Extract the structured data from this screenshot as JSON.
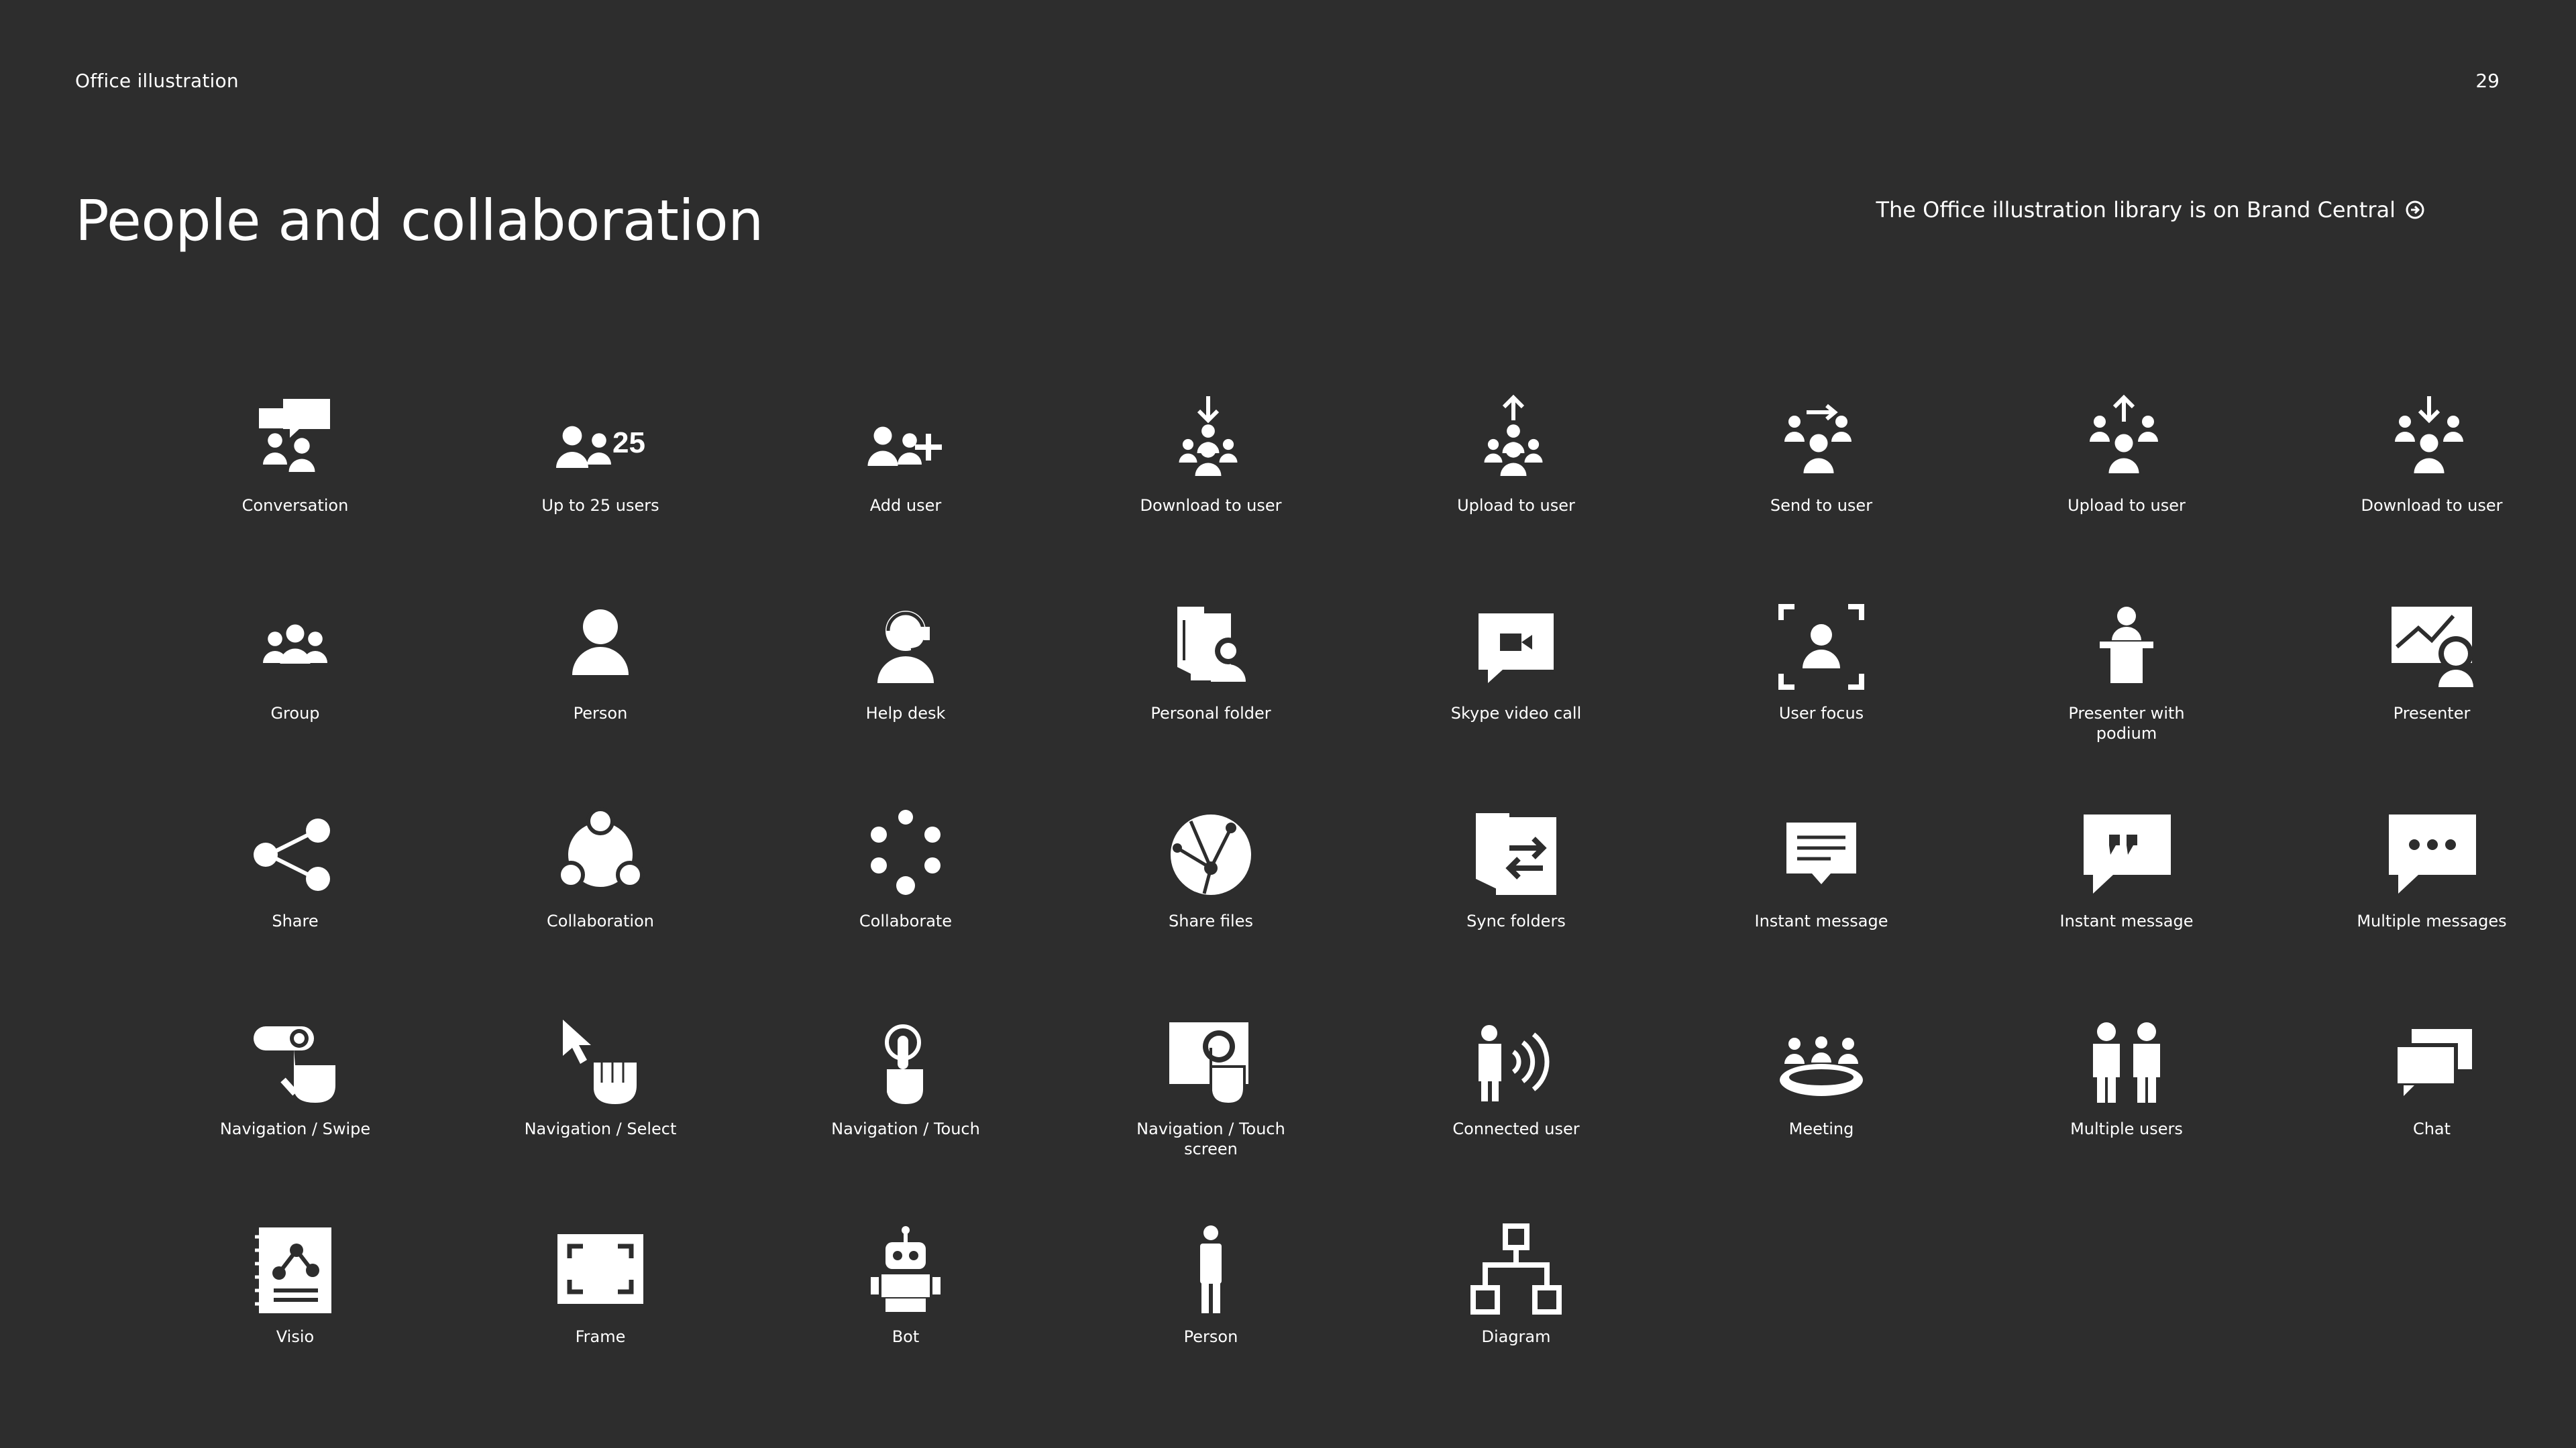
{
  "header": {
    "section": "Office illustration",
    "page_number": "29",
    "title": "People and collaboration",
    "link_text": "The Office illustration library is on Brand Central"
  },
  "icons": [
    {
      "label": "Conversation",
      "icon": "conversation-icon"
    },
    {
      "label": "Up to 25 users",
      "icon": "up-to-25-users-icon"
    },
    {
      "label": "Add user",
      "icon": "add-user-icon"
    },
    {
      "label": "Download to user",
      "icon": "download-to-user-icon"
    },
    {
      "label": "Upload to user",
      "icon": "upload-to-user-icon"
    },
    {
      "label": "Send to user",
      "icon": "send-to-user-icon"
    },
    {
      "label": "Upload to user",
      "icon": "upload-to-user-alt-icon"
    },
    {
      "label": "Download to user",
      "icon": "download-to-user-alt-icon"
    },
    {
      "label": "Group",
      "icon": "group-icon"
    },
    {
      "label": "Person",
      "icon": "person-icon"
    },
    {
      "label": "Help desk",
      "icon": "help-desk-icon"
    },
    {
      "label": "Personal folder",
      "icon": "personal-folder-icon"
    },
    {
      "label": "Skype video call",
      "icon": "skype-video-call-icon"
    },
    {
      "label": "User focus",
      "icon": "user-focus-icon"
    },
    {
      "label": "Presenter with podium",
      "icon": "presenter-podium-icon"
    },
    {
      "label": "Presenter",
      "icon": "presenter-icon"
    },
    {
      "label": "Share",
      "icon": "share-icon"
    },
    {
      "label": "Collaboration",
      "icon": "collaboration-icon"
    },
    {
      "label": "Collaborate",
      "icon": "collaborate-icon"
    },
    {
      "label": "Share files",
      "icon": "share-files-icon"
    },
    {
      "label": "Sync folders",
      "icon": "sync-folders-icon"
    },
    {
      "label": "Instant message",
      "icon": "instant-message-icon"
    },
    {
      "label": "Instant message",
      "icon": "instant-message-quote-icon"
    },
    {
      "label": "Multiple messages",
      "icon": "multiple-messages-icon"
    },
    {
      "label": "Navigation / Swipe",
      "icon": "navigation-swipe-icon"
    },
    {
      "label": "Navigation / Select",
      "icon": "navigation-select-icon"
    },
    {
      "label": "Navigation / Touch",
      "icon": "navigation-touch-icon"
    },
    {
      "label": "Navigation / Touch screen",
      "icon": "navigation-touch-screen-icon"
    },
    {
      "label": "Connected user",
      "icon": "connected-user-icon"
    },
    {
      "label": "Meeting",
      "icon": "meeting-icon"
    },
    {
      "label": "Multiple users",
      "icon": "multiple-users-icon"
    },
    {
      "label": "Chat",
      "icon": "chat-icon"
    },
    {
      "label": "Visio",
      "icon": "visio-icon"
    },
    {
      "label": "Frame",
      "icon": "frame-icon"
    },
    {
      "label": "Bot",
      "icon": "bot-icon"
    },
    {
      "label": "Person",
      "icon": "person-standing-icon"
    },
    {
      "label": "Diagram",
      "icon": "diagram-icon"
    }
  ],
  "colors": {
    "background": "#2d2d2d",
    "foreground": "#ffffff"
  }
}
